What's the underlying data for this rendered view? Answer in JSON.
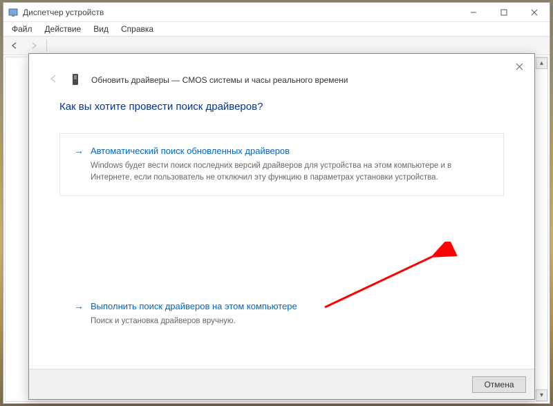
{
  "parent": {
    "title": "Диспетчер устройств",
    "menu": {
      "file": "Файл",
      "action": "Действие",
      "view": "Вид",
      "help": "Справка"
    }
  },
  "dialog": {
    "header": "Обновить драйверы — CMOS системы и часы реального времени",
    "question": "Как вы хотите провести поиск драйверов?",
    "opt1": {
      "title": "Автоматический поиск обновленных драйверов",
      "desc": "Windows будет вести поиск последних версий драйверов для устройства на этом компьютере и в Интернете, если пользователь не отключил эту функцию в параметрах установки устройства."
    },
    "opt2": {
      "title": "Выполнить поиск драйверов на этом компьютере",
      "desc": "Поиск и установка драйверов вручную."
    },
    "cancel": "Отмена"
  }
}
